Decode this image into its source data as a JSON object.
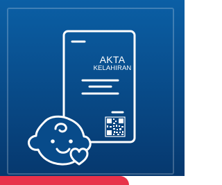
{
  "colors": {
    "panel_gradient_top": "#0b5fa5",
    "panel_gradient_bottom": "#06386e",
    "line": "#ffffff",
    "accent": "#e8324a"
  },
  "document": {
    "title_line1": "AKTA",
    "title_line2": "KELAHIRAN"
  },
  "icons": {
    "document": "document-icon",
    "qr": "qr-code-icon",
    "baby": "baby-face-icon",
    "heart": "heart-icon"
  }
}
